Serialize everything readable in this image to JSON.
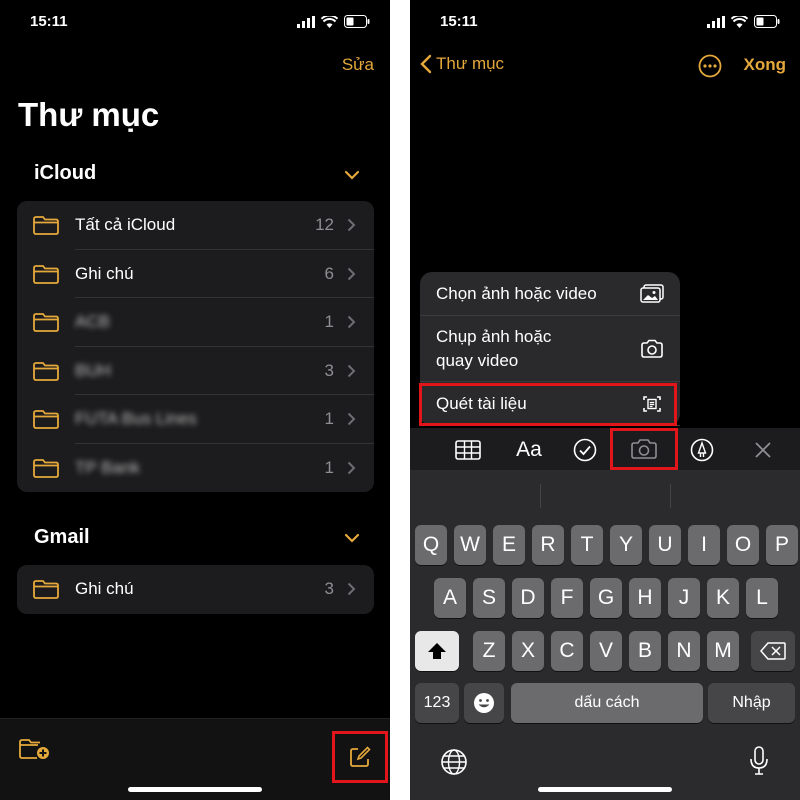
{
  "left": {
    "status_time": "15:11",
    "edit_label": "Sửa",
    "title": "Thư mục",
    "sections": [
      {
        "name": "iCloud",
        "rows": [
          {
            "label": "Tất cả iCloud",
            "count": "12"
          },
          {
            "label": "Ghi chú",
            "count": "6"
          },
          {
            "label": "ACB",
            "count": "1"
          },
          {
            "label": "BUH",
            "count": "3"
          },
          {
            "label": "FUTA Bus Lines",
            "count": "1"
          },
          {
            "label": "TP Bank",
            "count": "1"
          }
        ]
      },
      {
        "name": "Gmail",
        "rows": [
          {
            "label": "Ghi chú",
            "count": "3"
          }
        ]
      }
    ]
  },
  "right": {
    "status_time": "15:11",
    "back_label": "Thư mục",
    "done_label": "Xong",
    "menu": [
      {
        "line1": "Chọn ảnh hoặc video",
        "line2": "",
        "icon": "photo-library-icon"
      },
      {
        "line1": "Chụp ảnh hoặc",
        "line2": "quay video",
        "icon": "camera-icon"
      },
      {
        "line1": "Quét tài liệu",
        "line2": "",
        "icon": "scan-document-icon"
      }
    ],
    "toolbar": {
      "format_label": "Aa"
    },
    "keyboard": {
      "row1": [
        "Q",
        "W",
        "E",
        "R",
        "T",
        "Y",
        "U",
        "I",
        "O",
        "P"
      ],
      "row2": [
        "A",
        "S",
        "D",
        "F",
        "G",
        "H",
        "J",
        "K",
        "L"
      ],
      "row3": [
        "Z",
        "X",
        "C",
        "V",
        "B",
        "N",
        "M"
      ],
      "numbers_label": "123",
      "space_label": "dấu cách",
      "return_label": "Nhập"
    }
  },
  "colors": {
    "accent": "#e5a93b",
    "highlight": "#e0161b",
    "background": "#000000",
    "group": "#1c1c1e"
  }
}
